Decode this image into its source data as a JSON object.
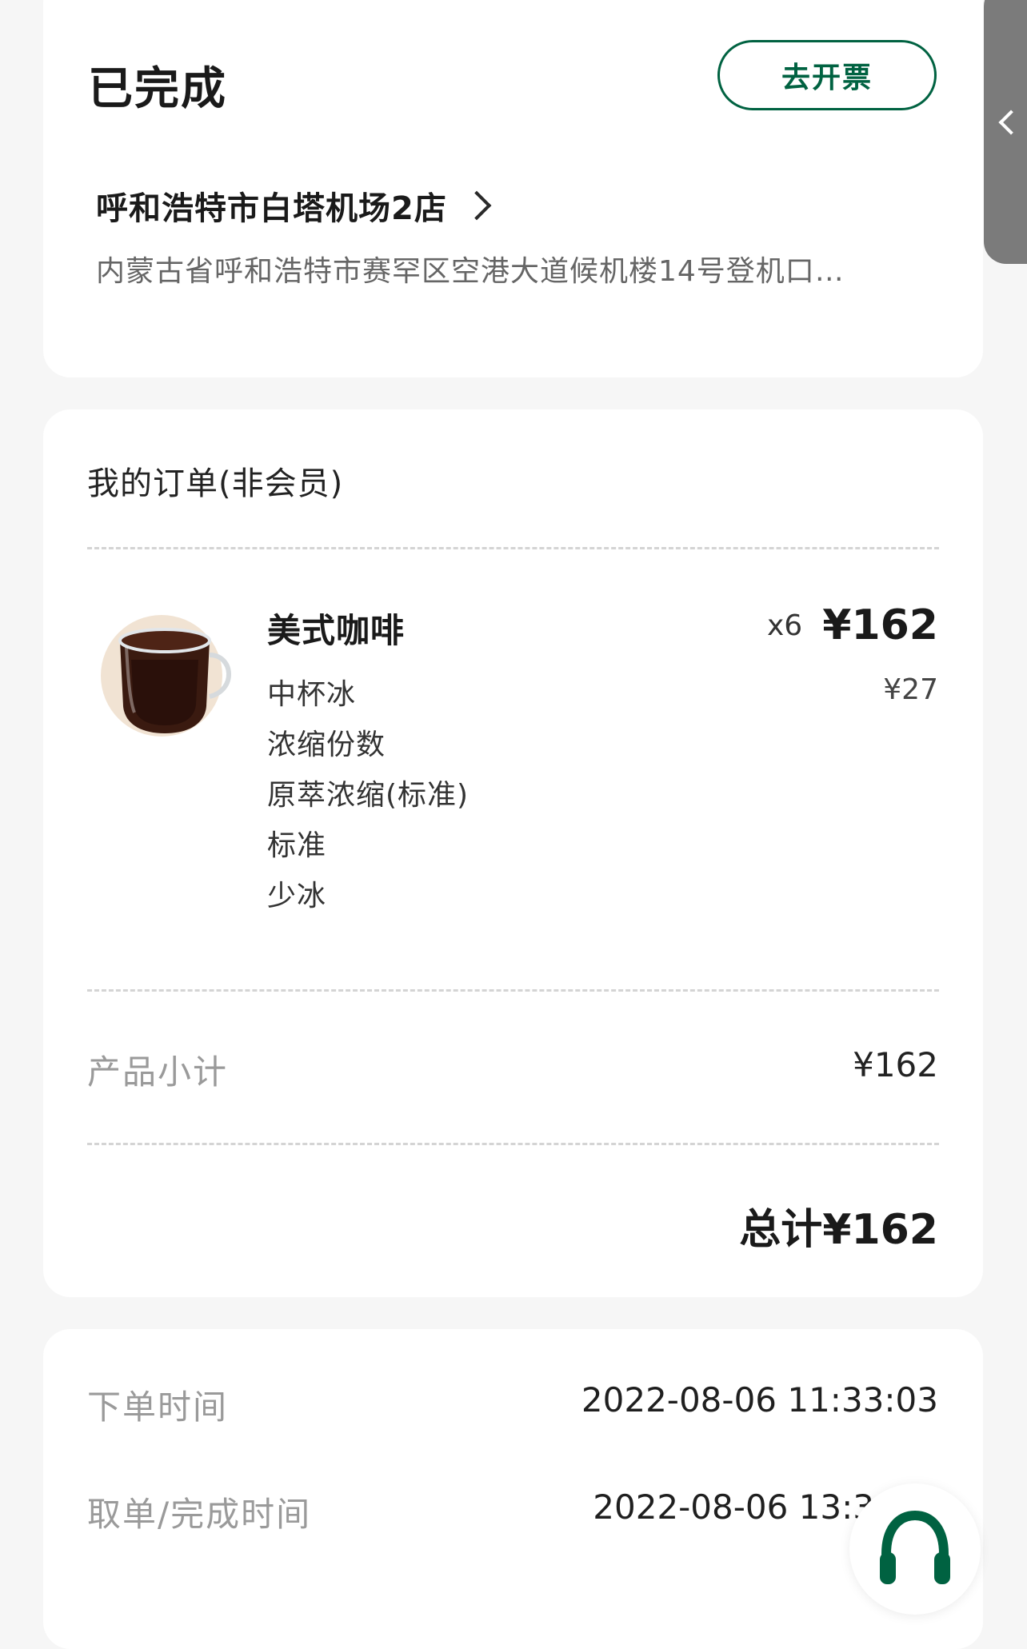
{
  "status": {
    "title": "已完成",
    "invoice_button": "去开票"
  },
  "store": {
    "name": "呼和浩特市白塔机场2店",
    "address": "内蒙古省呼和浩特市赛罕区空港大道候机楼14号登机口…"
  },
  "order": {
    "heading": "我的订单(非会员)",
    "items": [
      {
        "name": "美式咖啡",
        "quantity": "x6",
        "price": "¥162",
        "unit_price": "¥27",
        "specs": [
          "中杯冰",
          "浓缩份数",
          "原萃浓缩(标准)",
          "标准",
          "少冰"
        ]
      }
    ],
    "subtotal_label": "产品小计",
    "subtotal_value": "¥162",
    "total": "总计¥162"
  },
  "times": {
    "order_time_label": "下单时间",
    "order_time_value": "2022-08-06 11:33:03",
    "complete_time_label": "取单/完成时间",
    "complete_time_value": "2022-08-06 13:3"
  },
  "icons": {
    "side_tab": "chevron-left-icon",
    "store_link": "chevron-right-icon",
    "service": "headset-icon",
    "product": "coffee-cup-image"
  },
  "colors": {
    "accent": "#006241",
    "background": "#f6f6f6",
    "card": "#ffffff",
    "muted_text": "#9a9a9a",
    "side_tab": "#7b7b7b"
  }
}
